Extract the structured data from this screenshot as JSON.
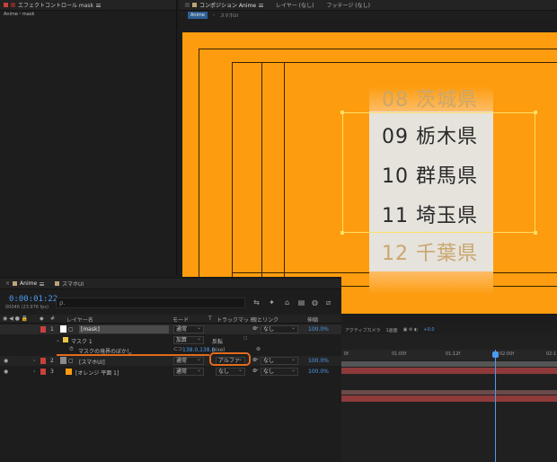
{
  "effects": {
    "tab_label": "エフェクトコントロール mask",
    "subtitle": "Anime・mask"
  },
  "composition": {
    "tabs": [
      {
        "label": "コンポジション Anime"
      },
      {
        "label": "レイヤー (なし)"
      },
      {
        "label": "フッテージ (なし)"
      }
    ],
    "crumbs": [
      "Anime",
      "スマホUI"
    ],
    "prefectures": [
      "08 茨城県",
      "09 栃木県",
      "10 群馬県",
      "11 埼玉県",
      "12 千葉県"
    ]
  },
  "viewer_toolbar": {
    "camera": "アクティブカメラ",
    "views": "1画面",
    "exposure": "+0.0"
  },
  "timeline": {
    "tabs": [
      {
        "label": "Anime"
      },
      {
        "label": "スマホUI"
      }
    ],
    "timecode": "0:00:01:22",
    "fps": "00046 (23.976 fps)",
    "search_placeholder": "ρ.",
    "columns": {
      "num": "#",
      "name": "レイヤー名",
      "mode": "モード",
      "t": "T",
      "trackmatte": "トラックマット",
      "parent": "親とリンク",
      "stretch": "伸縮"
    },
    "rows": [
      {
        "num": "1",
        "name": "[mask]",
        "mode": "通常",
        "trackmatte": "",
        "parent": "なし",
        "stretch": "100.0%",
        "label_color": "#c8413a"
      },
      {
        "name": "マスク 1",
        "mode": "加算",
        "inverted": "反転"
      },
      {
        "name": "マスクの境界のぼかし",
        "value": "138.0,138.0",
        "unit": "pixel"
      },
      {
        "num": "2",
        "name": "[スマホUI]",
        "mode": "通常",
        "trackmatte": "アルファ",
        "parent": "なし",
        "stretch": "100.0%",
        "label_color": "#c8413a"
      },
      {
        "num": "3",
        "name": "[オレンジ 平面 1]",
        "mode": "通常",
        "trackmatte": "なし",
        "parent": "なし",
        "stretch": "100.0%",
        "label_color": "#c8413a"
      }
    ],
    "ruler": [
      "0f",
      "01:00f",
      "01:12f",
      "02:00f",
      "02:1"
    ]
  },
  "colors": {
    "accent_blue": "#4c9bf0",
    "canvas_orange": "#fd9c0e",
    "highlight_orange": "#e26b1d"
  }
}
